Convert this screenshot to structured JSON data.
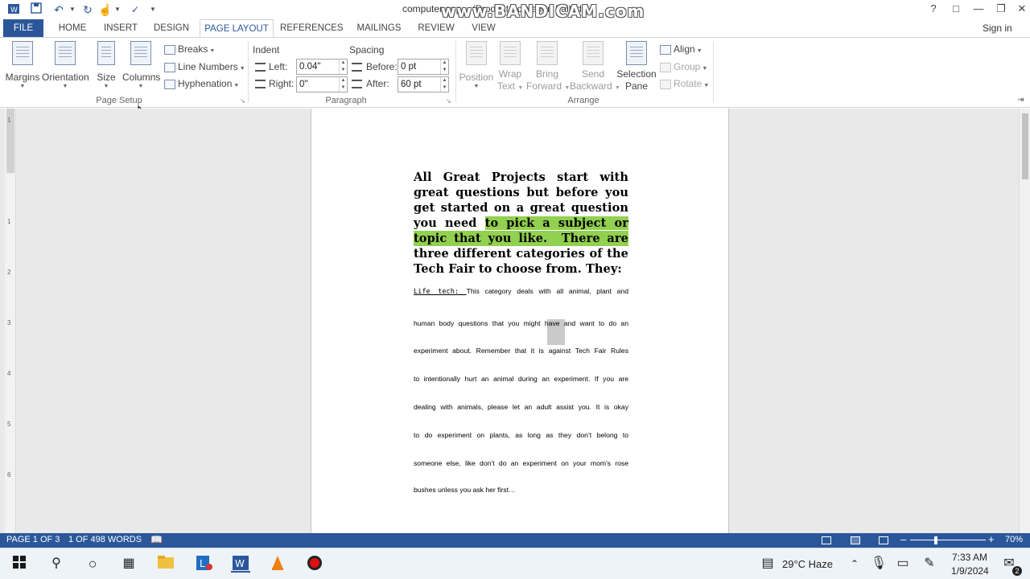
{
  "window": {
    "title": "computer app... (Product Activation Failed)",
    "watermark": "www.BANDICAM.com",
    "sign_in": "Sign in"
  },
  "tabs": [
    "FILE",
    "HOME",
    "INSERT",
    "DESIGN",
    "PAGE LAYOUT",
    "REFERENCES",
    "MAILINGS",
    "REVIEW",
    "VIEW"
  ],
  "ribbon": {
    "page_setup": {
      "margins": "Margins",
      "orientation": "Orientation",
      "size": "Size",
      "columns": "Columns",
      "breaks": "Breaks",
      "line_numbers": "Line Numbers",
      "hyphenation": "Hyphenation",
      "group_label": "Page Setup"
    },
    "paragraph": {
      "indent_label": "Indent",
      "spacing_label": "Spacing",
      "left_label": "Left:",
      "left_value": "0.04\"",
      "right_label": "Right:",
      "right_value": "0\"",
      "before_label": "Before:",
      "before_value": "0 pt",
      "after_label": "After:",
      "after_value": "60 pt",
      "group_label": "Paragraph"
    },
    "arrange": {
      "position": "Position",
      "wrap_text_1": "Wrap",
      "wrap_text_2": "Text",
      "bring_forward_1": "Bring",
      "bring_forward_2": "Forward",
      "send_backward_1": "Send",
      "send_backward_2": "Backward",
      "selection_pane_1": "Selection",
      "selection_pane_2": "Pane",
      "align": "Align",
      "group": "Group",
      "rotate": "Rotate",
      "group_label": "Arrange"
    }
  },
  "document": {
    "heading_lines": [
      {
        "pre": "All Great Projects start with",
        "hl": ""
      },
      {
        "pre": "great questions but before you",
        "hl": ""
      },
      {
        "pre": "get started on a great question",
        "hl": ""
      },
      {
        "pre": "you need ",
        "hl": "to pick a subject or"
      },
      {
        "pre": "",
        "hl": "topic that you like."
      },
      {
        "pre": "three different categories of the",
        "hl": ""
      },
      {
        "pre": "Tech Fair to choose from.  They:",
        "hl": ""
      }
    ],
    "heading_line5_rest": "  There are",
    "life_label": "Life tech: ",
    "body_lines": [
      "This category deals with all animal, plant and",
      "human body questions that you might have and want to do an",
      "experiment about.  Remember that it is against Tech Fair Rules",
      "to intentionally hurt an animal during an experiment. If you are",
      "dealing with animals, please let an adult assist you.  It is okay",
      "to do experiment on plants, as long as they don’t belong to",
      "someone else, like don’t do an experiment on your mom’s rose",
      "bushes unless you ask her first…"
    ],
    "ruler_numbers": [
      "1",
      "1",
      "2",
      "3",
      "4",
      "5",
      "6"
    ]
  },
  "status": {
    "page": "PAGE 1 OF 3",
    "words": "1 OF 498 WORDS",
    "zoom": "70%"
  },
  "taskbar": {
    "weather": "29°C  Haze",
    "time": "7:33 AM",
    "date": "1/9/2024",
    "notifications": "2"
  },
  "colors": {
    "accent": "#2b579a",
    "highlight": "#92d050"
  }
}
